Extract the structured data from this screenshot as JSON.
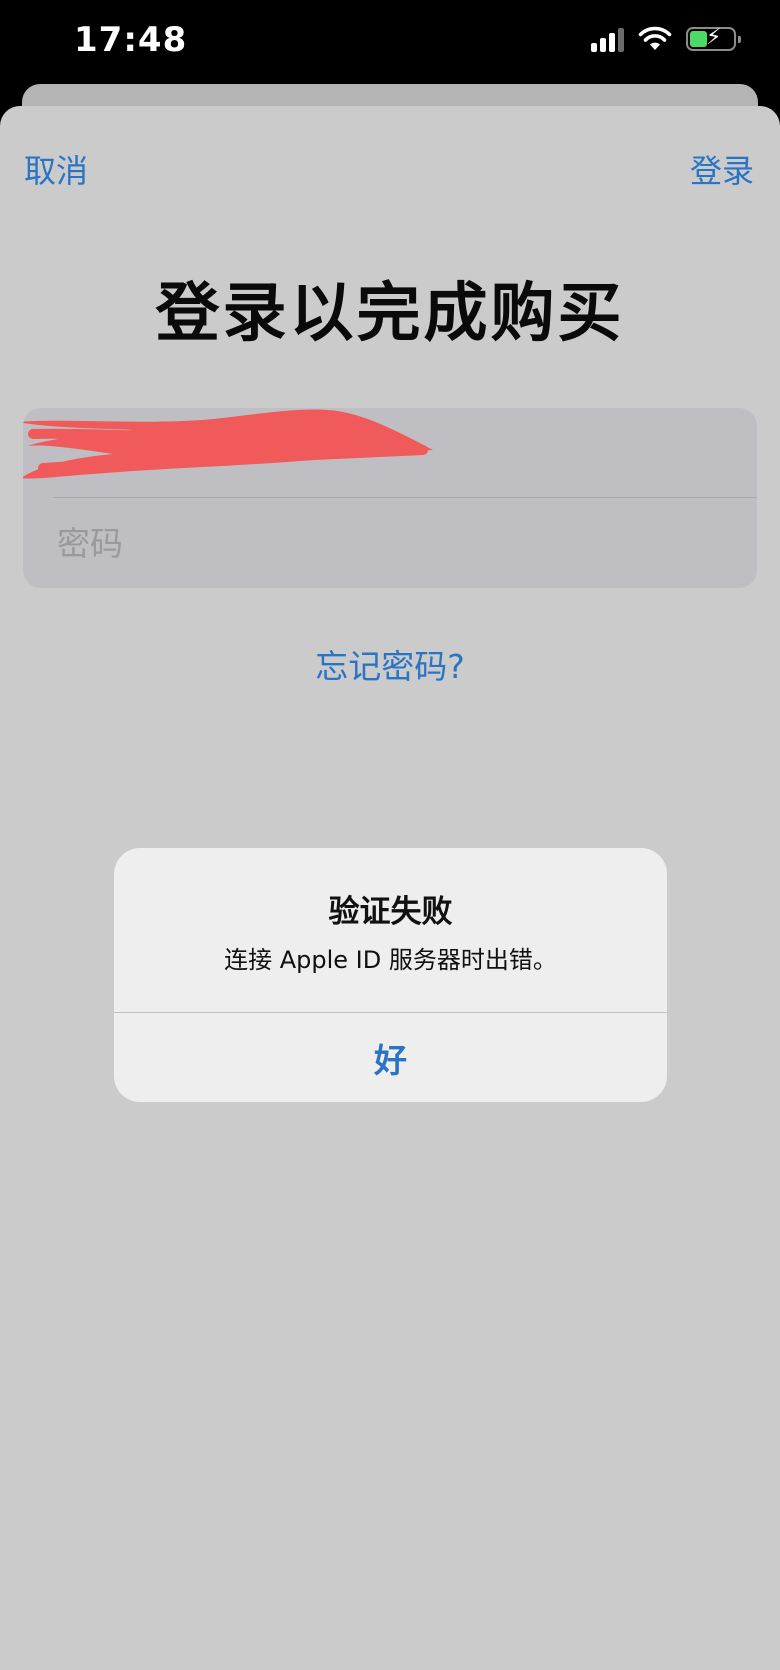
{
  "status_bar": {
    "time": "17:48",
    "icons": [
      "cellular-signal-icon",
      "wifi-icon",
      "battery-charging-icon"
    ]
  },
  "nav": {
    "cancel_label": "取消",
    "login_label": "登录"
  },
  "page": {
    "title": "登录以完成购买"
  },
  "form": {
    "apple_id_value": "",
    "password_placeholder": "密码"
  },
  "forgot_password_label": "忘记密码?",
  "alert": {
    "title": "验证失败",
    "message": "连接 Apple ID 服务器时出错。",
    "ok_label": "好"
  },
  "colors": {
    "accent": "#2b74c4",
    "sheet_background": "#cbcbcb",
    "alert_background": "#eeeeee",
    "redaction": "#f05a5a"
  }
}
